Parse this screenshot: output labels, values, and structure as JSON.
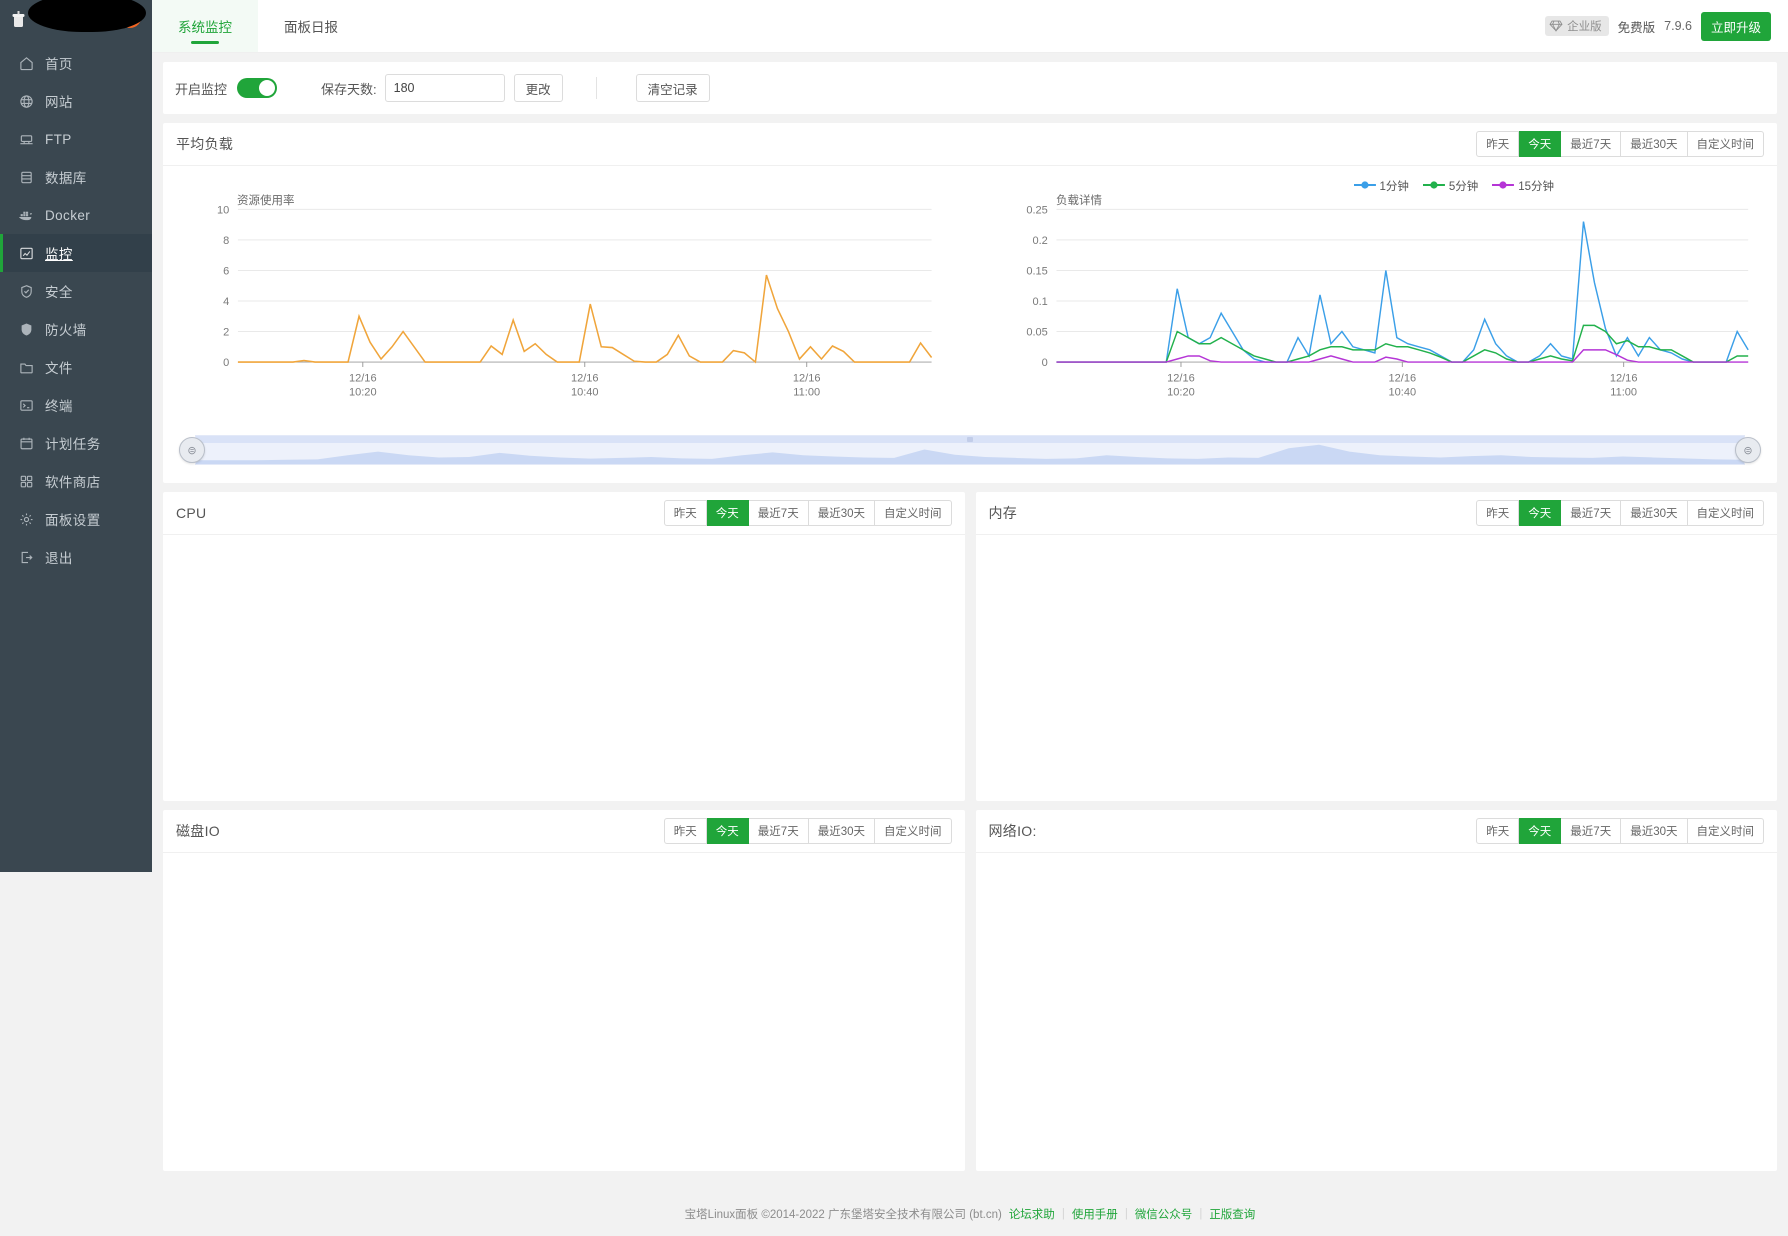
{
  "sidebar": {
    "logo_icon": "bt-panel-logo-icon",
    "items": [
      {
        "label": "首页",
        "icon": "home-icon",
        "active": false
      },
      {
        "label": "网站",
        "icon": "globe-icon",
        "active": false
      },
      {
        "label": "FTP",
        "icon": "ftp-icon",
        "active": false
      },
      {
        "label": "数据库",
        "icon": "database-icon",
        "active": false
      },
      {
        "label": "Docker",
        "icon": "docker-icon",
        "active": false
      },
      {
        "label": "监控",
        "icon": "monitor-chart-icon",
        "active": true
      },
      {
        "label": "安全",
        "icon": "shield-check-icon",
        "active": false
      },
      {
        "label": "防火墙",
        "icon": "firewall-shield-icon",
        "active": false
      },
      {
        "label": "文件",
        "icon": "folder-icon",
        "active": false
      },
      {
        "label": "终端",
        "icon": "terminal-icon",
        "active": false
      },
      {
        "label": "计划任务",
        "icon": "calendar-icon",
        "active": false
      },
      {
        "label": "软件商店",
        "icon": "grid-apps-icon",
        "active": false
      },
      {
        "label": "面板设置",
        "icon": "gear-icon",
        "active": false
      },
      {
        "label": "退出",
        "icon": "logout-icon",
        "active": false
      }
    ]
  },
  "topbar": {
    "tabs": [
      {
        "label": "系统监控",
        "active": true
      },
      {
        "label": "面板日报",
        "active": false
      }
    ],
    "enterprise_badge": "企业版",
    "edition": "免费版",
    "version": "7.9.6",
    "upgrade_button": "立即升级"
  },
  "toolbar": {
    "monitor_switch_label": "开启监控",
    "monitor_switch_on": true,
    "save_days_label": "保存天数:",
    "save_days_value": "180",
    "save_days_placeholder": "请输入天数",
    "change_button": "更改",
    "clear_button": "清空记录"
  },
  "ranges": {
    "yesterday": "昨天",
    "today": "今天",
    "last7": "最近7天",
    "last30": "最近30天",
    "custom": "自定义时间"
  },
  "panels": {
    "load": {
      "title": "平均负载",
      "active_range": "今天"
    },
    "cpu": {
      "title": "CPU",
      "active_range": "今天"
    },
    "memory": {
      "title": "内存",
      "active_range": "今天"
    },
    "disk_io": {
      "title": "磁盘IO",
      "active_range": "今天"
    },
    "network_io": {
      "title": "网络IO:",
      "active_range": "今天"
    }
  },
  "colors": {
    "accent_green": "#20a53a",
    "series_1min": "#3b9fe8",
    "series_5min": "#22b14c",
    "series_15min": "#b535d6",
    "series_usage": "#f0a53b",
    "sidebar_bg": "#3a4750",
    "sidebar_active_bg": "#32404a"
  },
  "chart_data": [
    {
      "type": "line",
      "title": "资源使用率",
      "xlabel": "",
      "ylabel": "",
      "ylim": [
        0,
        10
      ],
      "yticks": [
        0,
        2,
        4,
        6,
        8,
        10
      ],
      "xtick_labels": [
        "12/16\n10:20",
        "12/16\n10:40",
        "12/16\n11:00"
      ],
      "xtick_positions": [
        0.18,
        0.5,
        0.82
      ],
      "grid": true,
      "legend": "none",
      "series": [
        {
          "name": "资源使用率",
          "color": "#f0a53b",
          "values": [
            0,
            0,
            0,
            0,
            0,
            0,
            0.1,
            0,
            0,
            0,
            0,
            3.0,
            1.3,
            0.2,
            1.0,
            2.0,
            1.0,
            0,
            0,
            0,
            0,
            0,
            0,
            1.05,
            0.5,
            2.75,
            0.7,
            1.2,
            0.5,
            0,
            0,
            0,
            3.8,
            1.0,
            0.95,
            0.5,
            0.05,
            0,
            0,
            0.5,
            1.75,
            0.4,
            0,
            0,
            0,
            0.75,
            0.6,
            0,
            5.7,
            3.5,
            2.0,
            0.2,
            1.0,
            0.2,
            1.05,
            0.7,
            0,
            0,
            0,
            0,
            0,
            0,
            1.25,
            0.3
          ]
        }
      ]
    },
    {
      "type": "line",
      "title": "负载详情",
      "xlabel": "",
      "ylabel": "",
      "ylim": [
        0,
        0.25
      ],
      "yticks": [
        0,
        0.05,
        0.1,
        0.15,
        0.2,
        0.25
      ],
      "ytick_labels": [
        "0",
        "0.05",
        "0.1",
        "0.15",
        "0.2",
        "0.25"
      ],
      "xtick_labels": [
        "12/16\n10:20",
        "12/16\n10:40",
        "12/16\n11:00"
      ],
      "xtick_positions": [
        0.18,
        0.5,
        0.82
      ],
      "grid": true,
      "legend": "top-center",
      "series": [
        {
          "name": "1分钟",
          "color": "#3b9fe8",
          "values": [
            0,
            0,
            0,
            0,
            0,
            0,
            0,
            0,
            0,
            0,
            0,
            0.12,
            0.04,
            0.03,
            0.04,
            0.08,
            0.05,
            0.02,
            0.005,
            0,
            0,
            0,
            0.04,
            0.01,
            0.11,
            0.03,
            0.05,
            0.025,
            0.02,
            0.015,
            0.15,
            0.04,
            0.03,
            0.025,
            0.02,
            0.01,
            0,
            0,
            0.02,
            0.07,
            0.03,
            0.01,
            0,
            0,
            0.01,
            0.03,
            0.01,
            0.005,
            0.23,
            0.13,
            0.055,
            0.01,
            0.04,
            0.01,
            0.04,
            0.02,
            0.015,
            0.005,
            0,
            0,
            0,
            0,
            0.05,
            0.02
          ]
        },
        {
          "name": "5分钟",
          "color": "#22b14c",
          "values": [
            0,
            0,
            0,
            0,
            0,
            0,
            0,
            0,
            0,
            0,
            0,
            0.05,
            0.04,
            0.03,
            0.03,
            0.04,
            0.03,
            0.02,
            0.01,
            0.005,
            0,
            0,
            0.005,
            0.01,
            0.02,
            0.025,
            0.025,
            0.02,
            0.02,
            0.02,
            0.03,
            0.025,
            0.025,
            0.02,
            0.015,
            0.008,
            0,
            0,
            0.01,
            0.02,
            0.015,
            0.005,
            0,
            0,
            0.005,
            0.01,
            0.005,
            0.002,
            0.06,
            0.06,
            0.05,
            0.03,
            0.035,
            0.025,
            0.025,
            0.02,
            0.02,
            0.01,
            0,
            0,
            0,
            0,
            0.01,
            0.01
          ]
        },
        {
          "name": "15分钟",
          "color": "#b535d6",
          "values": [
            0,
            0,
            0,
            0,
            0,
            0,
            0,
            0,
            0,
            0,
            0,
            0.005,
            0.01,
            0.01,
            0.002,
            0,
            0,
            0,
            0,
            0,
            0,
            0,
            0,
            0,
            0.005,
            0.01,
            0.005,
            0,
            0,
            0,
            0.008,
            0.005,
            0,
            0,
            0,
            0,
            0,
            0,
            0,
            0,
            0,
            0,
            0,
            0,
            0,
            0,
            0,
            0,
            0.02,
            0.02,
            0.02,
            0.012,
            0.003,
            0,
            0,
            0,
            0,
            0,
            0,
            0,
            0,
            0,
            0,
            0
          ]
        }
      ]
    },
    {
      "type": "area",
      "title": "数据缩放预览",
      "legend": "none",
      "grid": false,
      "color": "#c3d3f2",
      "values": [
        0.08,
        0.08,
        0.08,
        0.1,
        0.12,
        0.3,
        0.45,
        0.3,
        0.2,
        0.22,
        0.4,
        0.28,
        0.2,
        0.15,
        0.18,
        0.22,
        0.16,
        0.14,
        0.3,
        0.42,
        0.3,
        0.24,
        0.2,
        0.18,
        0.55,
        0.32,
        0.22,
        0.18,
        0.14,
        0.16,
        0.3,
        0.22,
        0.16,
        0.14,
        0.2,
        0.18,
        0.6,
        0.75,
        0.45,
        0.3,
        0.24,
        0.2,
        0.26,
        0.3,
        0.22,
        0.2,
        0.18,
        0.24,
        0.2,
        0.16,
        0.12,
        0.1
      ]
    }
  ],
  "footer": {
    "copy": "宝塔Linux面板 ©2014-2022 广东堡塔安全技术有限公司 (bt.cn)",
    "links": [
      "论坛求助",
      "使用手册",
      "微信公众号",
      "正版查询"
    ],
    "separator": "|"
  }
}
